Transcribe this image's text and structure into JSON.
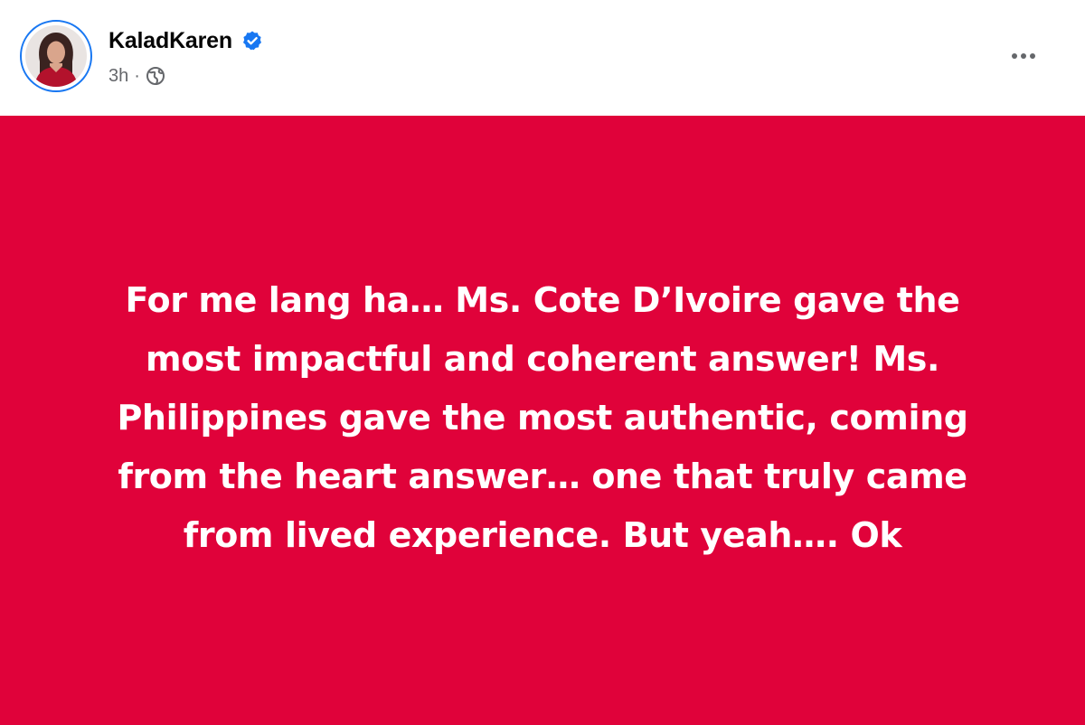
{
  "post": {
    "author": {
      "name": "KaladKaren",
      "verified": true,
      "avatar_icon": "profile-photo"
    },
    "meta": {
      "timestamp": "3h",
      "separator": "·",
      "audience_icon": "globe-icon"
    },
    "more_options_icon": "ellipsis-icon",
    "background_color": "#e0023a",
    "text": "For me lang ha… Ms. Cote D’Ivoire gave the most impactful and coherent answer! Ms. Philippines gave the most authentic, coming from the heart answer… one that truly came from lived experience. But yeah…. Ok"
  },
  "colors": {
    "verified_badge": "#1877f2",
    "secondary_text": "#65676b",
    "primary_text": "#050505"
  }
}
